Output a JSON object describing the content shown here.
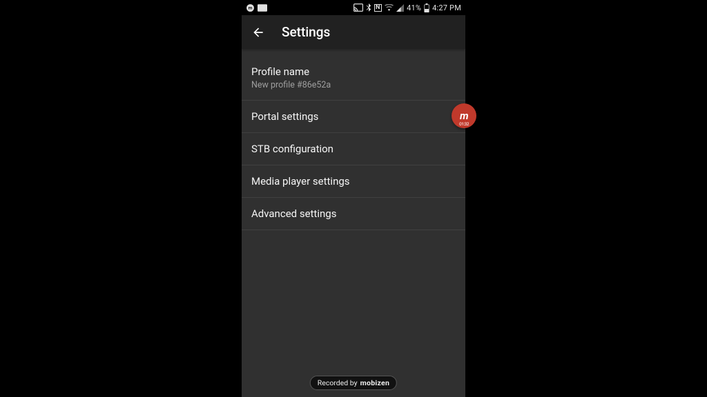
{
  "statusbar": {
    "battery_pct": "41%",
    "time": "4:27 PM",
    "nfc_label": "N"
  },
  "appbar": {
    "title": "Settings"
  },
  "rows": [
    {
      "title": "Profile name",
      "sub": "New profile #86e52a"
    },
    {
      "title": "Portal settings",
      "sub": null
    },
    {
      "title": "STB configuration",
      "sub": null
    },
    {
      "title": "Media player settings",
      "sub": null
    },
    {
      "title": "Advanced settings",
      "sub": null
    }
  ],
  "rec": {
    "bubble_timer": "01:32",
    "bubble_letter": "m",
    "tag_prefix": "Recorded by",
    "tag_brand": "mobizen"
  }
}
